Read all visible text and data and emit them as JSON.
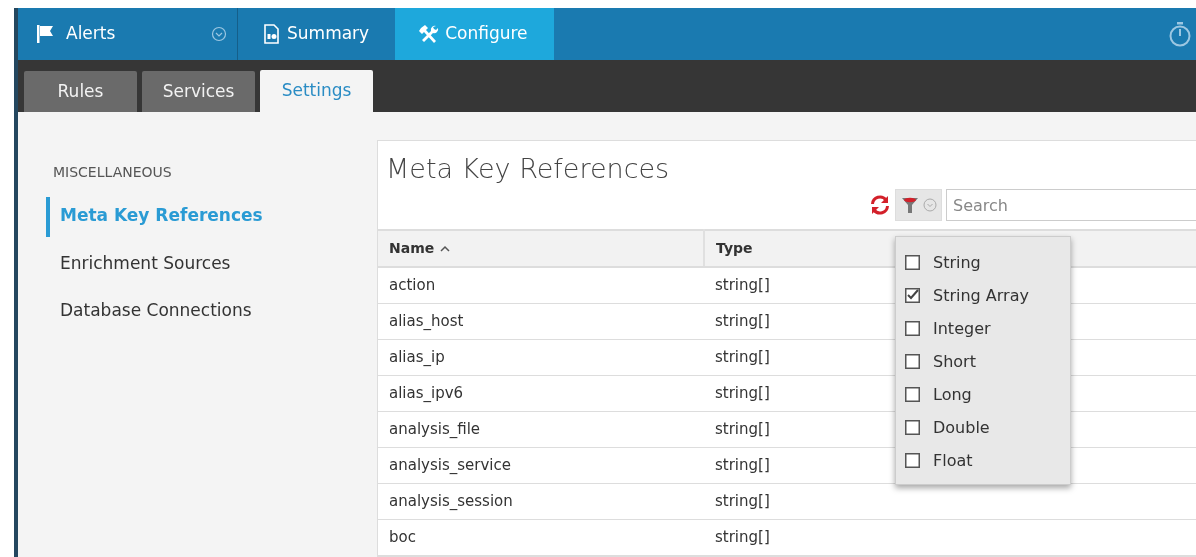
{
  "nav": {
    "app": {
      "label": "Alerts"
    },
    "items": [
      {
        "label": "Summary",
        "selected": false
      },
      {
        "label": "Configure",
        "selected": true
      }
    ]
  },
  "tabs": [
    {
      "label": "Rules",
      "selected": false
    },
    {
      "label": "Services",
      "selected": false
    },
    {
      "label": "Settings",
      "selected": true
    }
  ],
  "sidebar": {
    "section": "MISCELLANEOUS",
    "items": [
      {
        "label": "Meta Key References",
        "selected": true
      },
      {
        "label": "Enrichment Sources",
        "selected": false
      },
      {
        "label": "Database Connections",
        "selected": false
      }
    ]
  },
  "panel": {
    "title": "Meta Key References",
    "search": {
      "placeholder": "Search"
    },
    "table": {
      "columns": [
        {
          "label": "Name",
          "sorted": true
        },
        {
          "label": "Type",
          "sorted": false
        }
      ],
      "rows": [
        {
          "name": "action",
          "type": "string[]"
        },
        {
          "name": "alias_host",
          "type": "string[]"
        },
        {
          "name": "alias_ip",
          "type": "string[]"
        },
        {
          "name": "alias_ipv6",
          "type": "string[]"
        },
        {
          "name": "analysis_file",
          "type": "string[]"
        },
        {
          "name": "analysis_service",
          "type": "string[]"
        },
        {
          "name": "analysis_session",
          "type": "string[]"
        },
        {
          "name": "boc",
          "type": "string[]"
        }
      ]
    }
  },
  "filter_menu": {
    "items": [
      {
        "label": "String",
        "checked": false
      },
      {
        "label": "String Array",
        "checked": true
      },
      {
        "label": "Integer",
        "checked": false
      },
      {
        "label": "Short",
        "checked": false
      },
      {
        "label": "Long",
        "checked": false
      },
      {
        "label": "Double",
        "checked": false
      },
      {
        "label": "Float",
        "checked": false
      }
    ]
  }
}
